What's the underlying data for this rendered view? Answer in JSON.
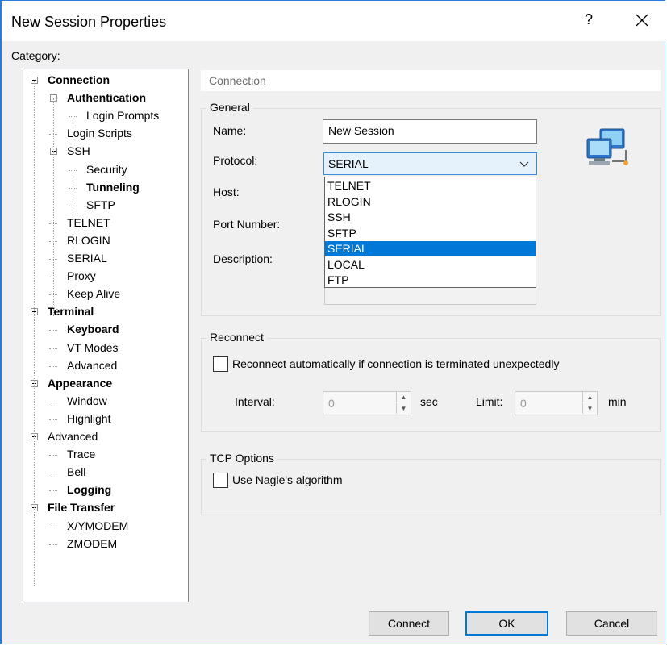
{
  "window": {
    "title": "New Session Properties",
    "help": "?",
    "close": "×"
  },
  "category_label": "Category:",
  "tree": [
    {
      "label": "Connection",
      "bold": true,
      "expanded": true
    },
    {
      "label": "Authentication",
      "bold": true,
      "expanded": true
    },
    {
      "label": "Login Prompts",
      "bold": false
    },
    {
      "label": "Login Scripts",
      "bold": false
    },
    {
      "label": "SSH",
      "bold": false,
      "expanded": true
    },
    {
      "label": "Security",
      "bold": false
    },
    {
      "label": "Tunneling",
      "bold": true
    },
    {
      "label": "SFTP",
      "bold": false
    },
    {
      "label": "TELNET",
      "bold": false
    },
    {
      "label": "RLOGIN",
      "bold": false
    },
    {
      "label": "SERIAL",
      "bold": false
    },
    {
      "label": "Proxy",
      "bold": false
    },
    {
      "label": "Keep Alive",
      "bold": false
    },
    {
      "label": "Terminal",
      "bold": true,
      "expanded": true
    },
    {
      "label": "Keyboard",
      "bold": true
    },
    {
      "label": "VT Modes",
      "bold": false
    },
    {
      "label": "Advanced",
      "bold": false
    },
    {
      "label": "Appearance",
      "bold": true,
      "expanded": true
    },
    {
      "label": "Window",
      "bold": false
    },
    {
      "label": "Highlight",
      "bold": false
    },
    {
      "label": "Advanced",
      "bold": false,
      "expanded": true
    },
    {
      "label": "Trace",
      "bold": false
    },
    {
      "label": "Bell",
      "bold": false
    },
    {
      "label": "Logging",
      "bold": true
    },
    {
      "label": "File Transfer",
      "bold": true,
      "expanded": true
    },
    {
      "label": "X/YMODEM",
      "bold": false
    },
    {
      "label": "ZMODEM",
      "bold": false
    }
  ],
  "panel": {
    "header": "Connection",
    "general": {
      "title": "General",
      "name_label": "Name:",
      "name_value": "New Session",
      "protocol_label": "Protocol:",
      "protocol_value": "SERIAL",
      "host_label": "Host:",
      "port_label": "Port Number:",
      "description_label": "Description:"
    },
    "protocol_options": [
      "TELNET",
      "RLOGIN",
      "SSH",
      "SFTP",
      "SERIAL",
      "LOCAL",
      "FTP"
    ],
    "protocol_selected_index": 4,
    "reconnect": {
      "title": "Reconnect",
      "checkbox_label": "Reconnect automatically if connection is terminated unexpectedly",
      "interval_label": "Interval:",
      "interval_value": "0",
      "interval_unit": "sec",
      "limit_label": "Limit:",
      "limit_value": "0",
      "limit_unit": "min"
    },
    "tcp": {
      "title": "TCP Options",
      "checkbox_label": "Use Nagle's algorithm"
    }
  },
  "buttons": {
    "connect": "Connect",
    "ok": "OK",
    "cancel": "Cancel"
  }
}
